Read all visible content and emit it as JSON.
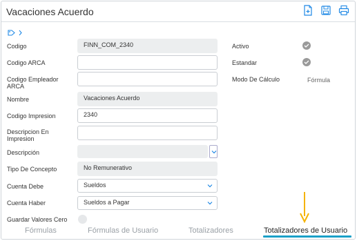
{
  "header": {
    "title": "Vacaciones Acuerdo",
    "icons": [
      "new-document-icon",
      "save-icon",
      "print-icon"
    ]
  },
  "form": {
    "codigo_label": "Codigo",
    "codigo_value": "FINN_COM_2340",
    "codigo_arca_label": "Codigo ARCA",
    "codigo_arca_value": "",
    "codigo_empleador_label": "Codigo Empleador ARCA",
    "codigo_empleador_value": "",
    "nombre_label": "Nombre",
    "nombre_value": "Vacaciones Acuerdo",
    "codigo_impresion_label": "Codigo Impresion",
    "codigo_impresion_value": "2340",
    "descripcion_impresion_label": "Descripcion En Impresion",
    "descripcion_impresion_value": "",
    "descripcion_label": "Descripción",
    "descripcion_value": "",
    "tipo_concepto_label": "Tipo De Concepto",
    "tipo_concepto_value": "No Remunerativo",
    "cuenta_debe_label": "Cuenta Debe",
    "cuenta_debe_value": "Sueldos",
    "cuenta_haber_label": "Cuenta Haber",
    "cuenta_haber_value": "Sueldos a Pagar",
    "guardar_label": "Guardar Valores Cero"
  },
  "right": {
    "activo_label": "Activo",
    "estandar_label": "Estandar",
    "modo_label": "Modo De Cálculo",
    "modo_value": "Fórmula"
  },
  "tabs": [
    "Fórmulas",
    "Fórmulas de Usuario",
    "Totalizadores",
    "Totalizadores de Usuario"
  ],
  "colors": {
    "accent": "#1e88e5",
    "tab_underline": "#1aa0c8",
    "arrow": "#f5b301",
    "readonly_bg": "#eceeef"
  }
}
